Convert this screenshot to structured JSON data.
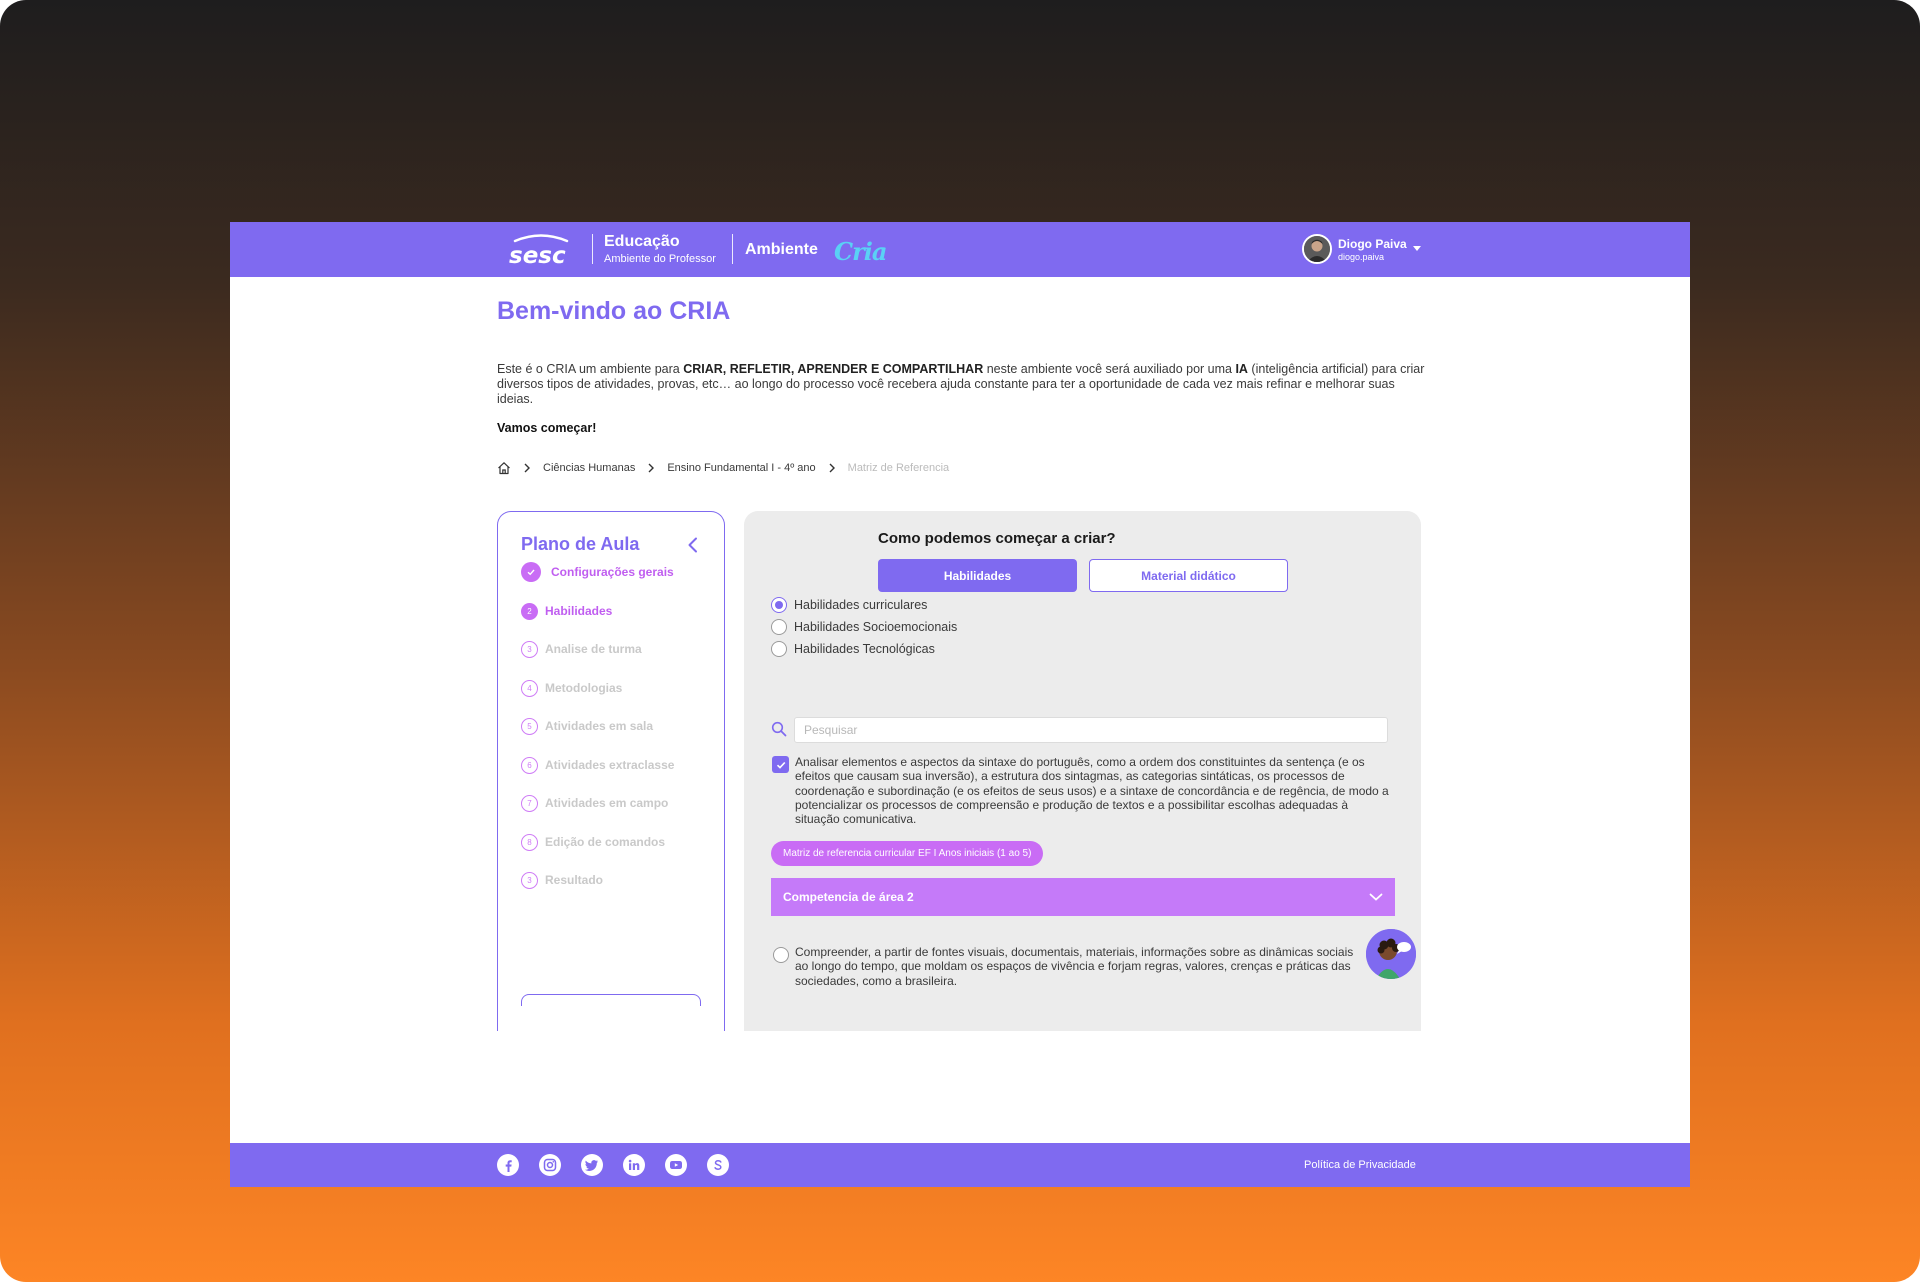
{
  "header": {
    "brand": "sesc",
    "edu_title": "Educação",
    "edu_subtitle": "Ambiente do Professor",
    "ambiente": "Ambiente",
    "cria_logo": "Cria",
    "user_name": "Diogo Paiva",
    "user_login": "diogo.paiva"
  },
  "welcome": {
    "title": "Bem-vindo ao CRIA",
    "intro_1": "Este é o CRIA um ambiente para ",
    "intro_bold_1": "CRIAR,  REFLETIR, APRENDER E COMPARTILHAR",
    "intro_2": " neste ambiente você será auxiliado por uma ",
    "intro_bold_2": "IA",
    "intro_3": " (inteligência artificial) para criar diversos tipos de atividades, provas, etc… ao longo do processo você recebera ajuda constante para ter a oportunidade de cada vez mais refinar e melhorar suas ideias.",
    "lets_go": "Vamos começar!"
  },
  "breadcrumb": {
    "items": [
      "Ciências Humanas",
      "Ensino Fundamental I - 4º ano"
    ],
    "current": "Matriz de Referencia"
  },
  "sidebar": {
    "title": "Plano de Aula",
    "steps": [
      {
        "num": "",
        "label": "Configurações gerais",
        "state": "done"
      },
      {
        "num": "2",
        "label": "Habilidades",
        "state": "active"
      },
      {
        "num": "3",
        "label": "Analise de turma",
        "state": "todo"
      },
      {
        "num": "4",
        "label": "Metodologias",
        "state": "todo"
      },
      {
        "num": "5",
        "label": "Atividades em sala",
        "state": "todo"
      },
      {
        "num": "6",
        "label": "Atividades extraclasse",
        "state": "todo"
      },
      {
        "num": "7",
        "label": "Atividades em campo",
        "state": "todo"
      },
      {
        "num": "8",
        "label": "Edição de comandos",
        "state": "todo"
      },
      {
        "num": "3",
        "label": "Resultado",
        "state": "todo"
      }
    ]
  },
  "main": {
    "question": "Como podemos começar a criar?",
    "btn_habilidades": "Habilidades",
    "btn_material": "Material didático",
    "radios": [
      {
        "label": "Habilidades curriculares",
        "selected": true
      },
      {
        "label": "Habilidades Socioemocionais",
        "selected": false
      },
      {
        "label": "Habilidades Tecnológicas",
        "selected": false
      }
    ],
    "search_placeholder": "Pesquisar",
    "skill_checked": "Analisar elementos e aspectos da sintaxe do português, como a ordem dos constituintes da sentença (e os efeitos que causam sua inversão), a estrutura dos sintagmas, as categorias sintáticas, os processos de coordenação e subordinação (e os efeitos de seus usos) e a sintaxe de concordância e de regência, de modo a potencializar os processos de compreensão e produção de textos e a possibilitar escolhas adequadas à situação comunicativa.",
    "tag": "Matriz de referencia curricular EF I Anos iniciais (1 ao 5)",
    "accordion": "Competencia de área 2",
    "skill_2": "Compreender, a partir de fontes visuais, documentais, materiais, informações sobre as dinâmicas sociais ao longo do tempo, que moldam os espaços de vivência e forjam regras, valores, crenças e práticas das sociedades, como a brasileira."
  },
  "footer": {
    "social_icons": [
      "facebook-icon",
      "instagram-icon",
      "twitter-icon",
      "linkedin-icon",
      "youtube-icon",
      "sesc-s-icon"
    ],
    "privacy": "Política de Privacidade"
  },
  "colors": {
    "primary": "#7f6af0",
    "accent": "#c96cf5",
    "accordion": "#c57af9",
    "panel": "#ececec",
    "cria": "#5ad1f5"
  }
}
